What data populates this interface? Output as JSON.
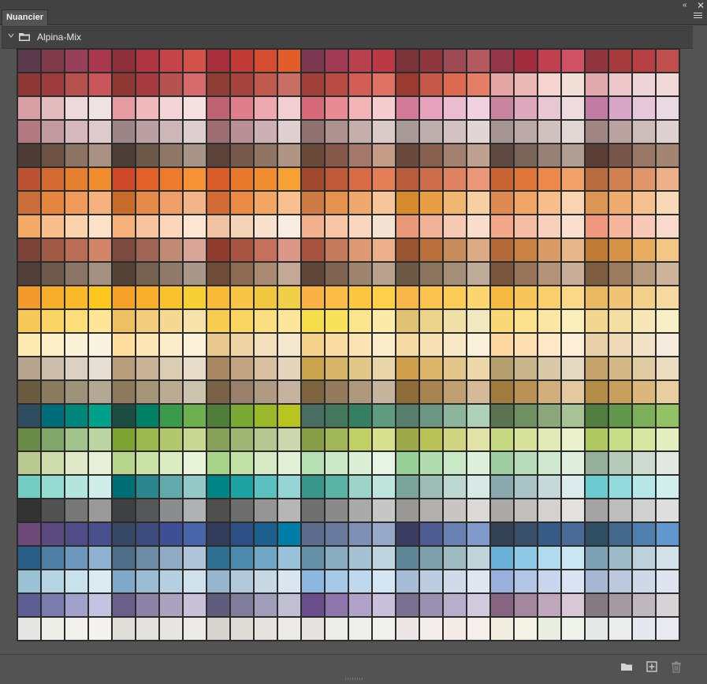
{
  "panel": {
    "tab_title": "Nuancier"
  },
  "header_icons": {
    "collapse": "double-chevron-left-icon",
    "close": "close-x-icon",
    "menu": "hamburger-menu-icon"
  },
  "group": {
    "name": "Alpina-Mix",
    "expanded": true,
    "icon": "folder-icon"
  },
  "footer": {
    "buttons": [
      "new-group-folder-icon",
      "new-swatch-plus-icon",
      "delete-trash-icon"
    ]
  },
  "swatches": [
    [
      "#5a3a4b",
      "#7f3b4c",
      "#983f59",
      "#a9384f",
      "#8e2f3c",
      "#ad3440",
      "#c5444a",
      "#d2524a",
      "#a62f3b",
      "#c03a36",
      "#d64c31",
      "#e35d2a",
      "#7c3851",
      "#a33a55",
      "#b8404f",
      "#bb3945",
      "#7a3338",
      "#8f363e",
      "#9e4a54",
      "#b55961",
      "#94354a",
      "#a32d3e",
      "#c0404f",
      "#d05264",
      "#91363e",
      "#a73a3c",
      "#b63f43",
      "#c0504d"
    ],
    [
      "#8e3735",
      "#9e3b3c",
      "#b5524e",
      "#c9545a",
      "#8f3834",
      "#a53b3e",
      "#b65250",
      "#d56b6c",
      "#8e3e35",
      "#a4443d",
      "#c05a4d",
      "#c86e64",
      "#a2403a",
      "#b84c45",
      "#d35e58",
      "#df7064",
      "#9a3a30",
      "#c55849",
      "#dd6a51",
      "#e67d66",
      "#e4a6a4",
      "#ecb8b6",
      "#f5d4cf",
      "#f2dfd8",
      "#e1a8ad",
      "#ecc6c9",
      "#eed3d7",
      "#f0d8d7"
    ],
    [
      "#d79ea3",
      "#e2bbbe",
      "#edd9da",
      "#f0e4e3",
      "#e69aa2",
      "#f0b8bd",
      "#f3d4d6",
      "#f4e1e0",
      "#bf6273",
      "#e07f8c",
      "#eea8b0",
      "#f2d0d2",
      "#d66a7b",
      "#e88b95",
      "#f2b4b7",
      "#f5cdd0",
      "#d27a98",
      "#e5a3bc",
      "#ecbcd0",
      "#efd2de",
      "#c7869e",
      "#dea9bc",
      "#e8c7d2",
      "#eddbe0",
      "#c07ca2",
      "#d8a6c6",
      "#e5c6da",
      "#ead9e2"
    ],
    [
      "#b17a82",
      "#c39aa1",
      "#d5b9bd",
      "#dec9cb",
      "#9c8587",
      "#baa0a2",
      "#cdb6b8",
      "#ddcecf",
      "#9d6d71",
      "#b99095",
      "#cdb0b3",
      "#dfcfd0",
      "#907270",
      "#ad928f",
      "#c4aeac",
      "#dacbc8",
      "#a99a97",
      "#bfaeae",
      "#d2c3c2",
      "#e2d6d5",
      "#a69592",
      "#bcaaa8",
      "#d0c1bf",
      "#e2d7d5",
      "#a08683",
      "#b9a2a0",
      "#cdbdba",
      "#ddd1cf"
    ],
    [
      "#4e3c36",
      "#6d5143",
      "#8d7363",
      "#a89182",
      "#4d3e37",
      "#6b5849",
      "#8e7766",
      "#a9948a",
      "#5c433a",
      "#76594b",
      "#917564",
      "#b09585",
      "#6c4a3b",
      "#85584a",
      "#a3786a",
      "#c59c88",
      "#6a4a3e",
      "#87604f",
      "#a3806f",
      "#bea190",
      "#5f4b44",
      "#7a6458",
      "#978177",
      "#b09e95",
      "#5b3e36",
      "#78564b",
      "#997866",
      "#a48473"
    ],
    [
      "#bb5234",
      "#d36a31",
      "#e68030",
      "#ef8c2e",
      "#cf4a2a",
      "#e2602a",
      "#ed7a2d",
      "#f59235",
      "#d85d2a",
      "#e7782c",
      "#f08d31",
      "#f7a036",
      "#a14a30",
      "#bf5a38",
      "#d86a45",
      "#e57f58",
      "#b95c3c",
      "#cd6d4c",
      "#df8362",
      "#eb9779",
      "#c96434",
      "#e1763a",
      "#ed894a",
      "#f2a06a",
      "#b86c40",
      "#cf7f50",
      "#e0966a",
      "#eeb08a"
    ],
    [
      "#c96d3a",
      "#e5853f",
      "#f09b5c",
      "#f7b17e",
      "#c96b2b",
      "#e68a4a",
      "#ef9e6a",
      "#f4b48a",
      "#d26a35",
      "#ea8a45",
      "#f3a565",
      "#f8c08c",
      "#cd7a45",
      "#e6914e",
      "#efa96f",
      "#f6c69a",
      "#d68a2c",
      "#e99e45",
      "#f1b672",
      "#f6cfa2",
      "#dd8a53",
      "#f0a466",
      "#f7bd8b",
      "#fad3b0",
      "#dd9556",
      "#efaa6f",
      "#f5c18f",
      "#f8d8b6"
    ],
    [
      "#f5a969",
      "#f8bf8c",
      "#fbd2ac",
      "#fde2c9",
      "#f6b07c",
      "#f9c49d",
      "#fbd6bb",
      "#fde5d3",
      "#f2c3a3",
      "#f5d3b8",
      "#f8e1cf",
      "#f9ece2",
      "#f2b08d",
      "#f7c5a6",
      "#f9d6c0",
      "#f4e2d3",
      "#e99878",
      "#f2b298",
      "#f6c9b4",
      "#f8dccc",
      "#f3a88a",
      "#f6bda5",
      "#f8d0be",
      "#fadfd1",
      "#ef987d",
      "#f6b49e",
      "#f8c8b8",
      "#fad9cd"
    ],
    [
      "#7d4338",
      "#a05a46",
      "#bb6c57",
      "#d38569",
      "#7c4a3e",
      "#9f6453",
      "#c08a74",
      "#d8a596",
      "#8f3c2e",
      "#a95543",
      "#c4705d",
      "#dd9789",
      "#a55340",
      "#c47a5c",
      "#de9a75",
      "#ecb08c",
      "#9a5431",
      "#b9703d",
      "#c88b5b",
      "#dcab86",
      "#b56a39",
      "#c98244",
      "#d99a66",
      "#e8b68b",
      "#bf7a35",
      "#d69347",
      "#e9ad62",
      "#f2c685"
    ],
    [
      "#514039",
      "#6d5a4d",
      "#8a7566",
      "#a49080",
      "#554237",
      "#76604f",
      "#907b6b",
      "#a9978a",
      "#6f4c38",
      "#8d6a52",
      "#ab8a73",
      "#c3a896",
      "#5f4638",
      "#7e6350",
      "#9f8470",
      "#b9a18f",
      "#6e5846",
      "#8b745e",
      "#a68f79",
      "#beab99",
      "#7a573e",
      "#97745a",
      "#b39379",
      "#c8ad98",
      "#7d5c42",
      "#9a7b5e",
      "#b59a7e",
      "#ccb39b"
    ],
    [
      "#f29a2c",
      "#f6ad2a",
      "#fab92a",
      "#fdc722",
      "#f6a22a",
      "#f8b02c",
      "#fac22d",
      "#f6cf37",
      "#f7ba39",
      "#f8c548",
      "#f2c740",
      "#f0ce47",
      "#fab146",
      "#fbbc47",
      "#fcc542",
      "#fdcf4a",
      "#f7b64a",
      "#fbc350",
      "#fccc5a",
      "#fdd570",
      "#f5b841",
      "#f8c55a",
      "#f9ce6e",
      "#fbd88a",
      "#eab762",
      "#f0c377",
      "#f3cf8c",
      "#f5d9a1"
    ],
    [
      "#f6c857",
      "#fbd466",
      "#fddd7a",
      "#fee597",
      "#eec064",
      "#f3cc7e",
      "#f5d893",
      "#f8e2ab",
      "#f8cc50",
      "#fad562",
      "#fbde7f",
      "#fce69e",
      "#f6dd4b",
      "#f8e25c",
      "#f9e68e",
      "#faebaa",
      "#e0c072",
      "#ebd38c",
      "#f0dfa6",
      "#f3e8bf",
      "#f9d977",
      "#fbe18e",
      "#fbe7a5",
      "#fbeebd",
      "#f3d692",
      "#f5dea3",
      "#f7e6b8",
      "#f8eec8"
    ],
    [
      "#fde9b2",
      "#fcefc7",
      "#fbf1d6",
      "#fbf3e2",
      "#fdde9f",
      "#fde6b5",
      "#fcedca",
      "#fcf2dc",
      "#e9c890",
      "#efd5a6",
      "#f3dfbb",
      "#f6e8cf",
      "#f6d38c",
      "#f8dba0",
      "#fae4b6",
      "#fbeccb",
      "#f5d9a3",
      "#f7e0b4",
      "#f9e8c6",
      "#faefd8",
      "#fcd7a1",
      "#fddfb3",
      "#fde7c6",
      "#fdeed8",
      "#e7cfa8",
      "#eed9b8",
      "#f2e2c8",
      "#f5eadb"
    ],
    [
      "#b6a48e",
      "#cbbda9",
      "#dbd0c1",
      "#e7dfd3",
      "#b79d7c",
      "#c9b497",
      "#dbccb4",
      "#e7dbc9",
      "#a88763",
      "#c3a482",
      "#d8bf9f",
      "#e6d4bd",
      "#c9a44d",
      "#d6b56a",
      "#e1c78a",
      "#e9d6a8",
      "#ce9e4a",
      "#dcb46a",
      "#e5c68a",
      "#edd6a9",
      "#b49e6e",
      "#c8b58b",
      "#d9c8a7",
      "#e5d9c2",
      "#c6a26c",
      "#d4b887",
      "#e1cba2",
      "#ebdcc0"
    ],
    [
      "#6c5c3f",
      "#8a7a5e",
      "#9f927a",
      "#b4a895",
      "#8d7a5d",
      "#a59478",
      "#baab92",
      "#cdc2ae",
      "#7a6247",
      "#98806a",
      "#b09a84",
      "#c5b3a0",
      "#7d6340",
      "#957b5d",
      "#ae987e",
      "#c6b59e",
      "#8e6d3a",
      "#a98453",
      "#c09f73",
      "#d5b998",
      "#a27c3e",
      "#ba9256",
      "#d0af7c",
      "#e2c9a0",
      "#b48c48",
      "#c99f5d",
      "#dbb77c",
      "#e8cda0"
    ],
    [
      "#2e4e5f",
      "#006d7a",
      "#00857b",
      "#00a08a",
      "#1b4d42",
      "#008065",
      "#3b9a4c",
      "#6eaf50",
      "#4e7e3a",
      "#78aa35",
      "#9cb82b",
      "#b8c422",
      "#496f62",
      "#45775c",
      "#358063",
      "#5e9b7f",
      "#577e6f",
      "#6b9683",
      "#8db59c",
      "#aecfb8",
      "#5c7351",
      "#6f9061",
      "#8aa87a",
      "#a8c497",
      "#4f7e40",
      "#61984c",
      "#7dae58",
      "#93c165"
    ],
    [
      "#6a8a4a",
      "#82a56a",
      "#a1c28b",
      "#bcd6a3",
      "#7da432",
      "#9ab84d",
      "#b3c86d",
      "#c9d793",
      "#87a05a",
      "#9fb574",
      "#b6c791",
      "#cdd7af",
      "#889e47",
      "#a0b657",
      "#bed066",
      "#d7e08e",
      "#9ea94b",
      "#b8c257",
      "#d1d482",
      "#e0e2a8",
      "#c7d882",
      "#d7e39d",
      "#e1eab6",
      "#ebf1cd",
      "#aec760",
      "#c7dc86",
      "#d7e7a2",
      "#e4eec0"
    ],
    [
      "#b9c98f",
      "#cfdcab",
      "#e0e8c7",
      "#e8efd8",
      "#b6d48c",
      "#cce3a7",
      "#dcecc2",
      "#e9f3da",
      "#a8d38a",
      "#c1e1a9",
      "#d5eac4",
      "#e3f0d8",
      "#b6e0b3",
      "#cbe9c6",
      "#daefd6",
      "#e6f4e3",
      "#98cf97",
      "#b0dcaf",
      "#c9e8c6",
      "#ddf0db",
      "#9ecea2",
      "#b8dbbb",
      "#cfe6cf",
      "#dfeedf",
      "#96af9b",
      "#b6cab9",
      "#cedbd0",
      "#e1e9e2"
    ],
    [
      "#73cdc3",
      "#96dbd1",
      "#b3e5dc",
      "#cfeeea",
      "#006f75",
      "#2b878d",
      "#61a9ab",
      "#93c8c7",
      "#008586",
      "#1ea3a2",
      "#5cbfc0",
      "#95d5d5",
      "#3a968a",
      "#5bb3a4",
      "#9ed4c8",
      "#bfe4dc",
      "#7aa39a",
      "#9cbdb6",
      "#bdd7d1",
      "#d7e9e5",
      "#8aa9ae",
      "#a9c3c6",
      "#c5d9db",
      "#dcebec",
      "#6ccbd1",
      "#92dadb",
      "#b6e6e6",
      "#d1eeed"
    ],
    [
      "#333333",
      "#525252",
      "#777777",
      "#9a9a9a",
      "#3e4041",
      "#555759",
      "#8a8c8e",
      "#b0b1b3",
      "#4f4f4f",
      "#6e6e6e",
      "#959595",
      "#b6b6b6",
      "#707070",
      "#8a8a8a",
      "#aaaaaa",
      "#c6c6c6",
      "#9a9896",
      "#b2b0ae",
      "#c8c6c4",
      "#dbdad8",
      "#aaa9a8",
      "#c0bfbe",
      "#d3d2d1",
      "#e2e1e0",
      "#a4a4a4",
      "#bdbdbd",
      "#d0d0d0",
      "#dedede"
    ],
    [
      "#6b4a78",
      "#5b4a80",
      "#4f4c88",
      "#48508d",
      "#374766",
      "#3d4c7c",
      "#3e4f95",
      "#4965a9",
      "#313c5c",
      "#2c5085",
      "#1d5f8e",
      "#007ea8",
      "#5e6c8e",
      "#69799d",
      "#7f90b6",
      "#98a8c9",
      "#3b3d63",
      "#4f5c93",
      "#6a81b4",
      "#8299cc",
      "#344256",
      "#3a4f6c",
      "#365b85",
      "#4a6a98",
      "#2f4d63",
      "#44698c",
      "#4f7fae",
      "#6197cf"
    ],
    [
      "#2a5e86",
      "#4d7ea6",
      "#6d97bd",
      "#8fb2d2",
      "#4d6d89",
      "#6e8ba6",
      "#90aac3",
      "#afc4d8",
      "#2f6f90",
      "#4d8aad",
      "#72a6c6",
      "#9ac1da",
      "#6690a8",
      "#88abc0",
      "#a6c2d2",
      "#c0d4e0",
      "#5e8696",
      "#7ea0ad",
      "#a0bac4",
      "#c0d3da",
      "#6ab0d8",
      "#90c9e7",
      "#b1daef",
      "#cbe6f3",
      "#7da1b5",
      "#9dbac9",
      "#bcd1dc",
      "#d2e0e7"
    ],
    [
      "#9bc1d5",
      "#b5d4e4",
      "#c9e1ec",
      "#dbebf2",
      "#7fa8c9",
      "#9abdd5",
      "#b6d0e2",
      "#cfe1ed",
      "#97b5cc",
      "#b1c9da",
      "#c7d8e5",
      "#dae6ef",
      "#8db7e1",
      "#a7c9e8",
      "#c0d8ee",
      "#d4e5f3",
      "#a7bcd7",
      "#bccde2",
      "#cfdbeb",
      "#dee6f1",
      "#9ab0dc",
      "#b3c5e6",
      "#c8d6ed",
      "#d9e3f3",
      "#a7b6d2",
      "#bcc8de",
      "#cfd8e8",
      "#dee5f0"
    ],
    [
      "#5d5e93",
      "#7b7cae",
      "#a0a2cc",
      "#c3c4e1",
      "#6b5f8a",
      "#8e82a6",
      "#aca2c0",
      "#c9c1d7",
      "#605c7e",
      "#807c9c",
      "#a09dba",
      "#c0bed3",
      "#6a4f8c",
      "#8e76ac",
      "#b2a1c9",
      "#cbc0dc",
      "#7b7092",
      "#9a90b0",
      "#b6aecb",
      "#d0cadf",
      "#866482",
      "#a4869f",
      "#c1a7bd",
      "#d9c6d6",
      "#867b82",
      "#a59aa1",
      "#c1b8be",
      "#d8d1d5"
    ],
    [
      "#e6e6e4",
      "#eeeee9",
      "#f1f0ea",
      "#f4f3ed",
      "#dfddd8",
      "#e2e1dd",
      "#e6e5e1",
      "#ecebe7",
      "#d8d4cf",
      "#dfdbd6",
      "#e6e3de",
      "#eceae6",
      "#e6e3e1",
      "#ecece8",
      "#eeeeea",
      "#f0f0ec",
      "#ece6e6",
      "#f3eeec",
      "#f4ebe6",
      "#f6eeea",
      "#f1eee0",
      "#f5f3e6",
      "#eaeee0",
      "#f0f3ea",
      "#e5e9e8",
      "#eaedec",
      "#e6e8ef",
      "#e9eaf1"
    ]
  ]
}
